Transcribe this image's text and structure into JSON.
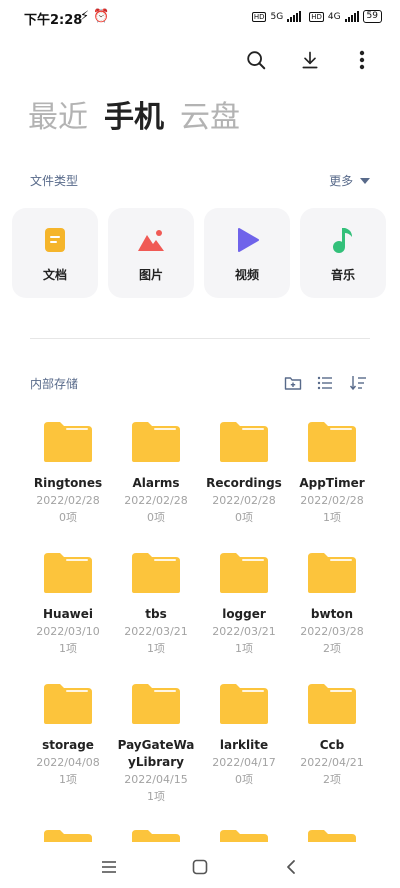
{
  "status": {
    "time": "下午2:28",
    "network1": "5G",
    "network2": "4G",
    "battery": "59"
  },
  "tabs": [
    {
      "label": "最近",
      "active": false
    },
    {
      "label": "手机",
      "active": true
    },
    {
      "label": "云盘",
      "active": false
    }
  ],
  "file_types": {
    "title": "文件类型",
    "more": "更多",
    "items": [
      {
        "label": "文档",
        "icon": "document-icon",
        "color": "#f5b52b"
      },
      {
        "label": "图片",
        "icon": "image-icon",
        "color": "#f05a55"
      },
      {
        "label": "视频",
        "icon": "video-icon",
        "color": "#6f63ea"
      },
      {
        "label": "音乐",
        "icon": "music-icon",
        "color": "#33c07a"
      }
    ]
  },
  "storage": {
    "title": "内部存储",
    "folders": [
      {
        "name": "Ringtones",
        "date": "2022/02/28",
        "count": "0项"
      },
      {
        "name": "Alarms",
        "date": "2022/02/28",
        "count": "0项"
      },
      {
        "name": "Recordings",
        "date": "2022/02/28",
        "count": "0项"
      },
      {
        "name": "AppTimer",
        "date": "2022/02/28",
        "count": "1项"
      },
      {
        "name": "Huawei",
        "date": "2022/03/10",
        "count": "1项"
      },
      {
        "name": "tbs",
        "date": "2022/03/21",
        "count": "1项"
      },
      {
        "name": "logger",
        "date": "2022/03/21",
        "count": "1项"
      },
      {
        "name": "bwton",
        "date": "2022/03/28",
        "count": "2项"
      },
      {
        "name": "storage",
        "date": "2022/04/08",
        "count": "1项"
      },
      {
        "name": "PayGateWayLibrary",
        "date": "2022/04/15",
        "count": "1项"
      },
      {
        "name": "larklite",
        "date": "2022/04/17",
        "count": "0项"
      },
      {
        "name": "Ccb",
        "date": "2022/04/21",
        "count": "2项"
      }
    ]
  },
  "colors": {
    "folder": "#fcc43c",
    "accent_text": "#586a8a"
  }
}
